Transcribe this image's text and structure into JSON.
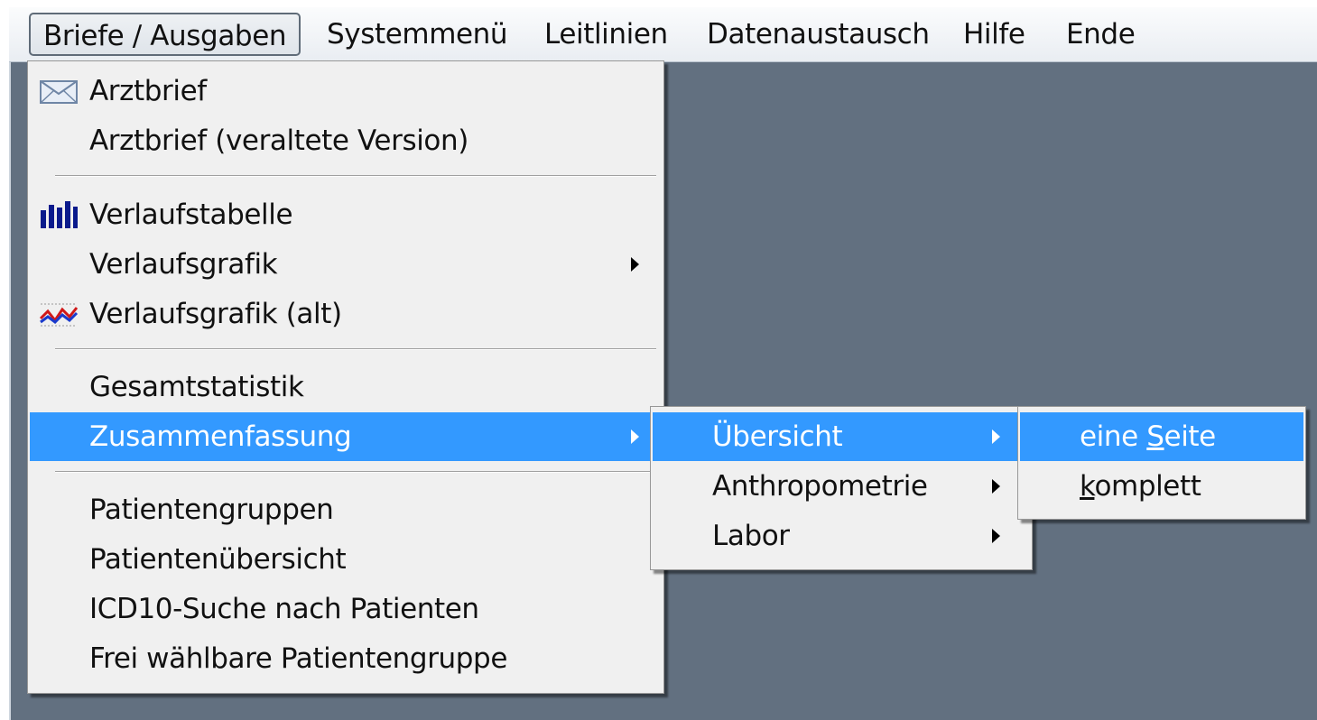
{
  "menubar": {
    "items": [
      {
        "label": "Briefe / Ausgaben"
      },
      {
        "label": "Systemmenü"
      },
      {
        "label": "Leitlinien"
      },
      {
        "label": "Datenaustausch"
      },
      {
        "label": "Hilfe"
      },
      {
        "label": "Ende"
      }
    ]
  },
  "main_menu": {
    "items": [
      {
        "label": "Arztbrief",
        "icon": "envelope-icon"
      },
      {
        "label": "Arztbrief (veraltete Version)"
      },
      {
        "label": "Verlaufstabelle",
        "icon": "bar-chart-icon"
      },
      {
        "label": "Verlaufsgrafik",
        "submenu": true
      },
      {
        "label": "Verlaufsgrafik (alt)",
        "icon": "line-chart-icon"
      },
      {
        "label": "Gesamtstatistik"
      },
      {
        "label": "Zusammenfassung",
        "submenu": true,
        "highlighted": true
      },
      {
        "label": "Patientengruppen"
      },
      {
        "label": "Patientenübersicht"
      },
      {
        "label": "ICD10-Suche nach Patienten"
      },
      {
        "label": "Frei wählbare Patientengruppe"
      }
    ]
  },
  "submenu_zusammenfassung": {
    "items": [
      {
        "label": "Übersicht",
        "submenu": true,
        "highlighted": true
      },
      {
        "label": "Anthropometrie",
        "submenu": true
      },
      {
        "label": "Labor",
        "submenu": true
      }
    ]
  },
  "submenu_uebersicht": {
    "items": [
      {
        "label_pre": "eine ",
        "label_accel": "S",
        "label_post": "eite",
        "highlighted": true
      },
      {
        "label_pre": "",
        "label_accel": "k",
        "label_post": "omplett"
      }
    ]
  },
  "colors": {
    "highlight": "#3399ff",
    "desktop": "#627080",
    "menu_bg": "#f0f0f0"
  }
}
